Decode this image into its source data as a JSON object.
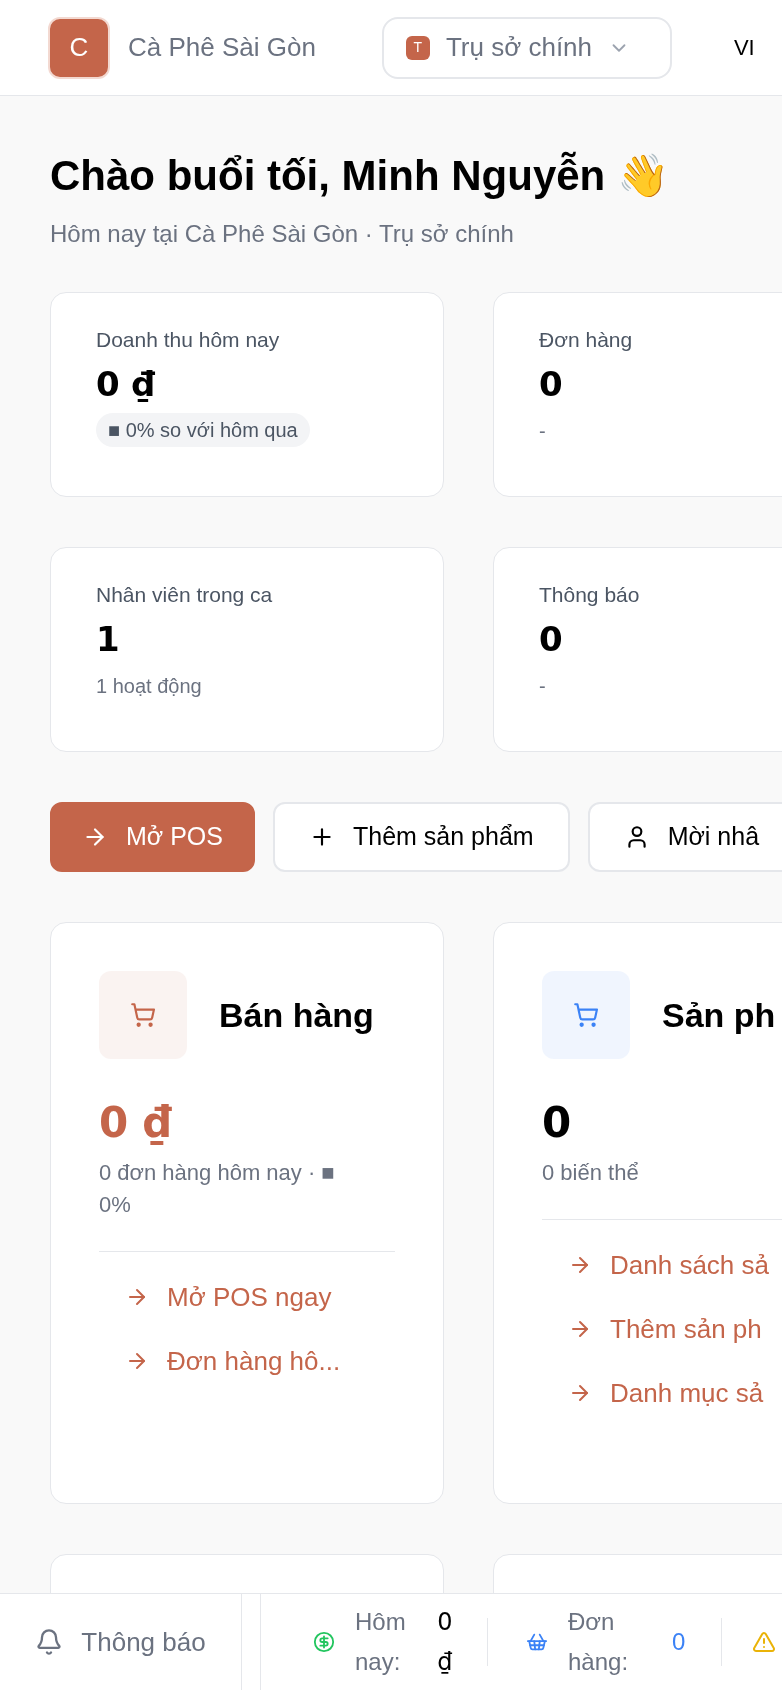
{
  "header": {
    "brand_initial": "C",
    "brand_name": "Cà Phê Sài Gòn",
    "branch": {
      "initial": "T",
      "name": "Trụ sở chính"
    },
    "language": "VI"
  },
  "greeting": {
    "title": "Chào buổi tối, Minh Nguyễn 👋",
    "subtitle": "Hôm nay tại Cà Phê Sài Gòn · Trụ sở chính"
  },
  "stats": [
    {
      "label": "Doanh thu hôm nay",
      "value": "0 ₫",
      "note": "■ 0% so với hôm qua",
      "kind": "badge"
    },
    {
      "label": "Đơn hàng",
      "value": "0",
      "note": "-",
      "kind": "text"
    },
    {
      "label": "Nhân viên trong ca",
      "value": "1",
      "note": "1 hoạt động",
      "kind": "text"
    },
    {
      "label": "Thông báo",
      "value": "0",
      "note": "-",
      "kind": "text"
    }
  ],
  "quick_actions": [
    {
      "label": "Mở POS",
      "kind": "primary"
    },
    {
      "label": "Thêm sản phẩm",
      "kind": "secondary"
    },
    {
      "label": "Mời nhâ",
      "kind": "secondary"
    }
  ],
  "modules": [
    {
      "title": "Bán hàng",
      "color": "#c4654a",
      "value": "0 ₫",
      "accent_value": true,
      "note": "0 đơn hàng hôm nay · ■ 0%",
      "links": [
        "Mở POS ngay",
        "Đơn hàng hô..."
      ]
    },
    {
      "title": "Sản ph",
      "color": "#3b82f6",
      "value": "0",
      "accent_value": false,
      "note": "0 biến thể",
      "links": [
        "Danh sách sả",
        "Thêm sản ph",
        "Danh mục sả"
      ]
    }
  ],
  "bottom_bar": {
    "notifications": "Thông báo",
    "today_label": "Hôm nay:",
    "today_value": "0 ₫",
    "orders_label": "Đơn hàng:",
    "orders_value": "0"
  }
}
